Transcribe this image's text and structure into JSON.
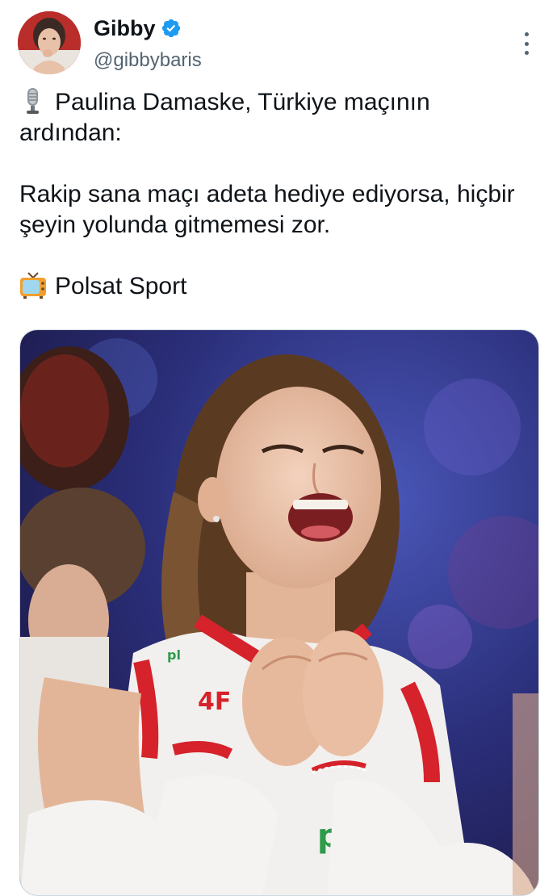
{
  "author": {
    "display_name": "Gibby",
    "handle": "@gibbybaris",
    "verified": true,
    "verified_color": "#1d9bf0"
  },
  "tweet": {
    "line1_icon": "microphone-icon",
    "line1": "Paulina Damaske, Türkiye maçının ardından:",
    "line2": "Rakip sana maçı adeta hediye ediyorsa, hiçbir şeyin yolunda gitmemesi zor.",
    "line3_icon": "television-icon",
    "line3": "Polsat Sport"
  },
  "media": {
    "logos": {
      "left": "pl",
      "center": "4F",
      "bottom": "p"
    }
  },
  "colors": {
    "text": "#0f1419",
    "secondary": "#536471",
    "border": "#cfd9de"
  }
}
